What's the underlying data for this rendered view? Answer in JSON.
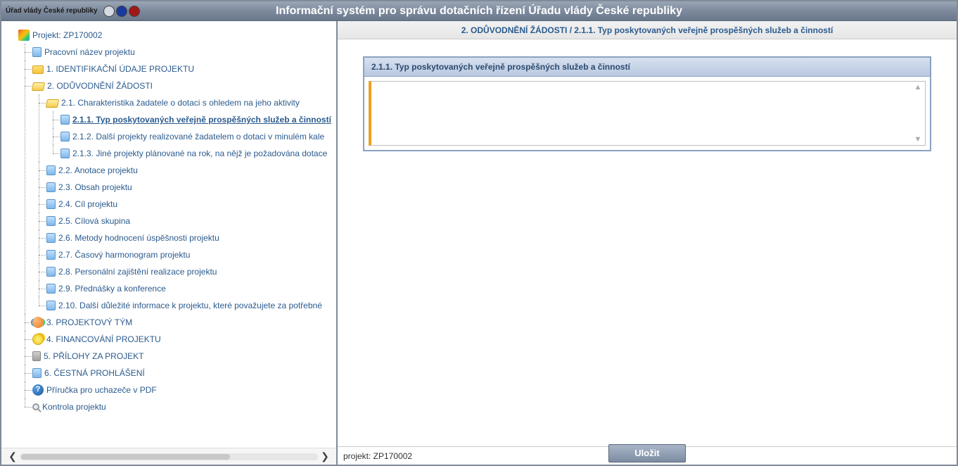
{
  "header": {
    "org_label": "Úřad vlády České republiky",
    "title": "Informační systém pro správu dotačních řízení Úřadu vlády České republiky"
  },
  "tree": {
    "root_label": "Projekt: ZP170002",
    "children": [
      {
        "id": "prac-nazev",
        "icon": "doc",
        "label": "Pracovní název projektu"
      },
      {
        "id": "sec1",
        "icon": "folder-closed",
        "label": "1. IDENTIFIKAČNÍ ÚDAJE PROJEKTU"
      },
      {
        "id": "sec2",
        "icon": "folder-open",
        "label": "2. ODŮVODNĚNÍ ŽÁDOSTI",
        "children": [
          {
            "id": "s2-1",
            "icon": "folder-open",
            "label": "2.1. Charakteristika žadatele o dotaci s ohledem na jeho aktivity",
            "children": [
              {
                "id": "s2-1-1",
                "icon": "doc",
                "label": "2.1.1. Typ poskytovaných veřejně prospěšných služeb a činností",
                "selected": true
              },
              {
                "id": "s2-1-2",
                "icon": "doc",
                "label": "2.1.2. Další projekty realizované žadatelem o dotaci v minulém kale"
              },
              {
                "id": "s2-1-3",
                "icon": "doc",
                "label": "2.1.3. Jiné projekty plánované na rok, na nějž je požadována dotace"
              }
            ]
          },
          {
            "id": "s2-2",
            "icon": "doc",
            "label": "2.2. Anotace projektu"
          },
          {
            "id": "s2-3",
            "icon": "doc",
            "label": "2.3. Obsah projektu"
          },
          {
            "id": "s2-4",
            "icon": "doc",
            "label": "2.4. Cíl projektu"
          },
          {
            "id": "s2-5",
            "icon": "doc",
            "label": "2.5. Cílová skupina"
          },
          {
            "id": "s2-6",
            "icon": "doc",
            "label": "2.6. Metody hodnocení úspěšnosti projektu"
          },
          {
            "id": "s2-7",
            "icon": "doc",
            "label": "2.7. Časový harmonogram projektu"
          },
          {
            "id": "s2-8",
            "icon": "doc",
            "label": "2.8. Personální zajištění realizace projektu"
          },
          {
            "id": "s2-9",
            "icon": "doc",
            "label": "2.9. Přednášky a konference"
          },
          {
            "id": "s2-10",
            "icon": "doc",
            "label": "2.10. Další důležité informace k projektu, které považujete za potřebné"
          }
        ]
      },
      {
        "id": "sec3",
        "icon": "team",
        "label": "3. PROJEKTOVÝ TÝM"
      },
      {
        "id": "sec4",
        "icon": "coins",
        "label": "4. FINANCOVÁNÍ PROJEKTU"
      },
      {
        "id": "sec5",
        "icon": "attach",
        "label": "5. PŘÍLOHY ZA PROJEKT"
      },
      {
        "id": "sec6",
        "icon": "doc",
        "label": "6. ČESTNÁ PROHLÁŠENÍ"
      },
      {
        "id": "manual",
        "icon": "help",
        "label": "Příručka pro uchazeče v PDF"
      },
      {
        "id": "check",
        "icon": "search",
        "label": "Kontrola projektu"
      }
    ]
  },
  "right": {
    "breadcrumb": "2. ODŮVODNĚNÍ ŽÁDOSTI / 2.1.1. Typ poskytovaných veřejně prospěšných služeb a činností",
    "form_title": "2.1.1. Typ poskytovaných veřejně prospěšných služeb a činností",
    "textarea_value": "",
    "footer_project": "projekt: ZP170002",
    "save_label": "Uložit"
  },
  "colors": {
    "badge1": "#d5d9e1",
    "badge2": "#1a3a9e",
    "badge3": "#a01818"
  }
}
